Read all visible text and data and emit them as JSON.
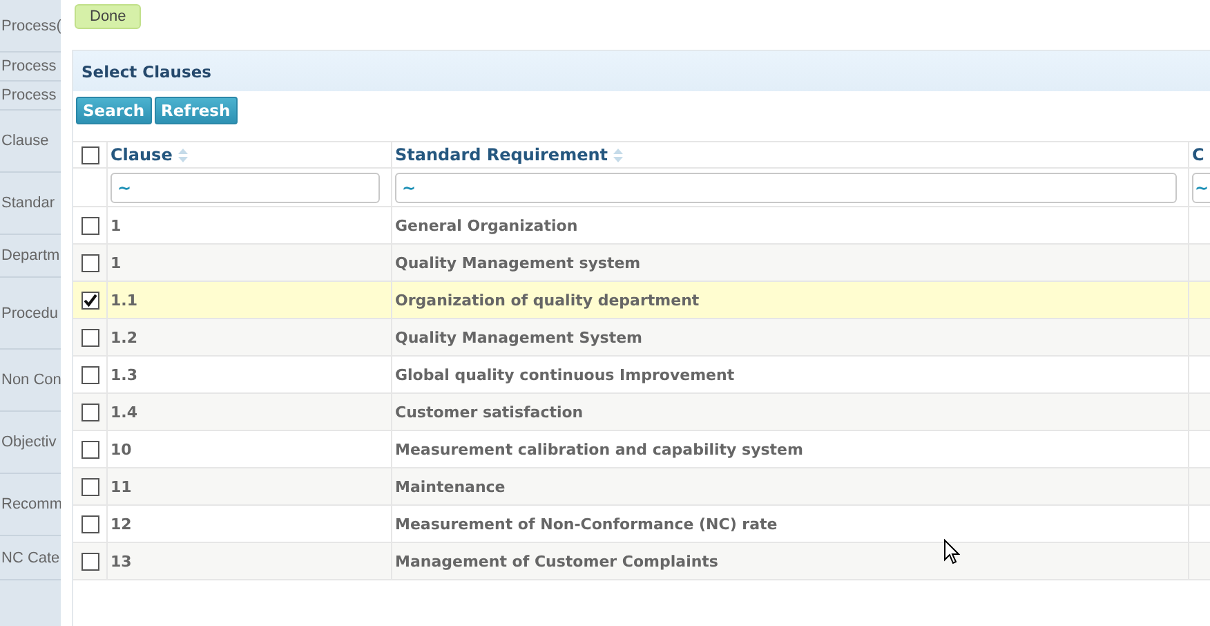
{
  "sidebar": {
    "items": [
      {
        "label": "Process("
      },
      {
        "label": "Process"
      },
      {
        "label": "Process"
      },
      {
        "label": "Clause"
      },
      {
        "label": "Standar"
      },
      {
        "label": "Departm"
      },
      {
        "label": "Procedu"
      },
      {
        "label": "Non Con"
      },
      {
        "label": "Objectiv"
      },
      {
        "label": "Recomm"
      },
      {
        "label": "NC Cate"
      }
    ]
  },
  "done_button": "Done",
  "panel": {
    "title": "Select Clauses",
    "buttons": [
      "Search",
      "Refresh"
    ]
  },
  "table": {
    "select_all_checked": false,
    "columns": [
      {
        "label": "Clause",
        "filter": "~"
      },
      {
        "label": "Standard Requirement",
        "filter": "~"
      },
      {
        "label": "C",
        "filter": "~"
      }
    ],
    "rows": [
      {
        "clause": "1",
        "requirement": "General Organization",
        "checked": false
      },
      {
        "clause": "1",
        "requirement": "Quality Management system",
        "checked": false
      },
      {
        "clause": "1.1",
        "requirement": "Organization of quality department",
        "checked": true
      },
      {
        "clause": "1.2",
        "requirement": "Quality Management System",
        "checked": false
      },
      {
        "clause": "1.3",
        "requirement": "Global quality continuous Improvement",
        "checked": false
      },
      {
        "clause": "1.4",
        "requirement": "Customer satisfaction",
        "checked": false
      },
      {
        "clause": "10",
        "requirement": "Measurement calibration and capability system",
        "checked": false
      },
      {
        "clause": "11",
        "requirement": "Maintenance",
        "checked": false
      },
      {
        "clause": "12",
        "requirement": "Measurement of Non-Conformance (NC) rate",
        "checked": false
      },
      {
        "clause": "13",
        "requirement": "Management of Customer Complaints",
        "checked": false
      }
    ]
  }
}
